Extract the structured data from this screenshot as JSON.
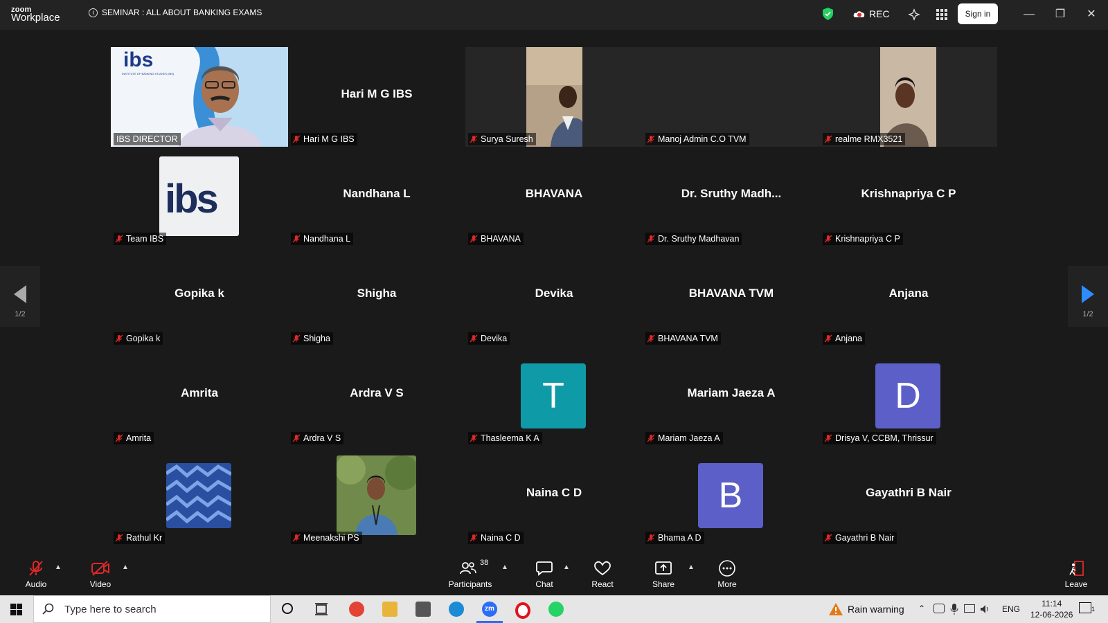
{
  "app": {
    "brand_top": "zoom",
    "brand_bottom": "Workplace",
    "meeting_title": "SEMINAR : ALL ABOUT BANKING EXAMS",
    "rec_label": "REC",
    "sign_in_label": "Sign in"
  },
  "gallery": {
    "page_left": "1/2",
    "page_right": "1/2",
    "tiles": [
      {
        "name": "IBS DIRECTOR",
        "big": ""
      },
      {
        "name": "Hari M G IBS",
        "big": "Hari M G IBS"
      },
      {
        "name": "Surya Suresh",
        "big": ""
      },
      {
        "name": "Manoj Admin C.O TVM",
        "big": ""
      },
      {
        "name": "realme RMX3521",
        "big": ""
      },
      {
        "name": "Team IBS",
        "big": ""
      },
      {
        "name": "Nandhana L",
        "big": "Nandhana L"
      },
      {
        "name": "BHAVANA",
        "big": "BHAVANA"
      },
      {
        "name": "Dr. Sruthy Madhavan",
        "big": "Dr. Sruthy Madh..."
      },
      {
        "name": "Krishnapriya C P",
        "big": "Krishnapriya C P"
      },
      {
        "name": "Gopika k",
        "big": "Gopika k"
      },
      {
        "name": "Shigha",
        "big": "Shigha"
      },
      {
        "name": "Devika",
        "big": "Devika"
      },
      {
        "name": "BHAVANA TVM",
        "big": "BHAVANA TVM"
      },
      {
        "name": "Anjana",
        "big": "Anjana"
      },
      {
        "name": "Amrita",
        "big": "Amrita"
      },
      {
        "name": "Ardra V S",
        "big": "Ardra V S"
      },
      {
        "name": "Thasleema K A",
        "big": "",
        "avatar": "T"
      },
      {
        "name": "Mariam Jaeza A",
        "big": "Mariam Jaeza A"
      },
      {
        "name": "Drisya V, CCBM, Thrissur",
        "big": "",
        "avatar": "D"
      },
      {
        "name": "Rathul Kr",
        "big": ""
      },
      {
        "name": "Meenakshi PS",
        "big": ""
      },
      {
        "name": "Naina C D",
        "big": "Naina C D"
      },
      {
        "name": "Bhama A D",
        "big": "",
        "avatar": "B"
      },
      {
        "name": "Gayathri B Nair",
        "big": "Gayathri B Nair"
      }
    ],
    "logo_text": "ibs",
    "logo_subtext": "INSTITUTE OF BANKING STUDIES (IBS)"
  },
  "toolbar": {
    "audio": "Audio",
    "video": "Video",
    "participants": "Participants",
    "participants_count": "38",
    "chat": "Chat",
    "react": "React",
    "share": "Share",
    "more": "More",
    "leave": "Leave"
  },
  "taskbar": {
    "search_placeholder": "Type here to search",
    "weather": "Rain warning",
    "lang": "ENG",
    "time": "11:14",
    "date": "12-06-2026",
    "notif_count": "1"
  },
  "colors": {
    "active_speaker": "#23d160",
    "avatar_teal": "#0f9aa8",
    "avatar_purple": "#5b5fc7",
    "muted_red": "#e02828",
    "accent_blue": "#2d8cff"
  }
}
